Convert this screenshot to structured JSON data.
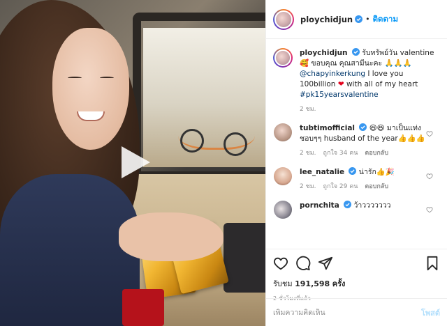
{
  "header": {
    "username": "ploychidjun",
    "follow_label": "ติดตาม",
    "separator": "•"
  },
  "caption": {
    "username": "ploychidjun",
    "text_1": "รับทรัพย์วัน valentine 🥰 ขอบคุณ คุณสามีนะคะ 🙏🙏🙏",
    "mention": "@chapyinkerkung",
    "text_2": "I love you 100billion",
    "text_3": "with all of my heart",
    "hashtag": "#pk15yearsvalentine",
    "time": "2 ชม."
  },
  "comments": [
    {
      "username": "tubtimofficial",
      "text": "😆😆 มาเป็นแท่ง ชอบๆๆ husband of the year👍👍👍",
      "time": "2 ชม.",
      "likes": "ถูกใจ 34 คน",
      "reply": "ตอบกลับ"
    },
    {
      "username": "lee_natalie",
      "text": "น่ารัก👍🎉",
      "time": "2 ชม.",
      "likes": "ถูกใจ 29 คน",
      "reply": "ตอบกลับ"
    },
    {
      "username": "pornchita",
      "text": "ว้าววววววว"
    }
  ],
  "stats": {
    "views_label": "รับชม",
    "views_count": "191,598",
    "views_unit": "ครั้ง",
    "posted_ago": "2 ชั่วโมงที่แล้ว"
  },
  "add_comment": {
    "placeholder": "เพิ่มความคิดเห็น",
    "post_label": "โพสต์"
  },
  "colors": {
    "link_blue": "#0095f6",
    "verified_blue": "#3897f0",
    "muted_gray": "#8e8e8e",
    "heart_red": "#e3001b"
  },
  "icons": [
    "play-icon",
    "verified-icon",
    "heart-icon",
    "comment-icon",
    "share-icon",
    "bookmark-icon",
    "like-comment-icon"
  ]
}
